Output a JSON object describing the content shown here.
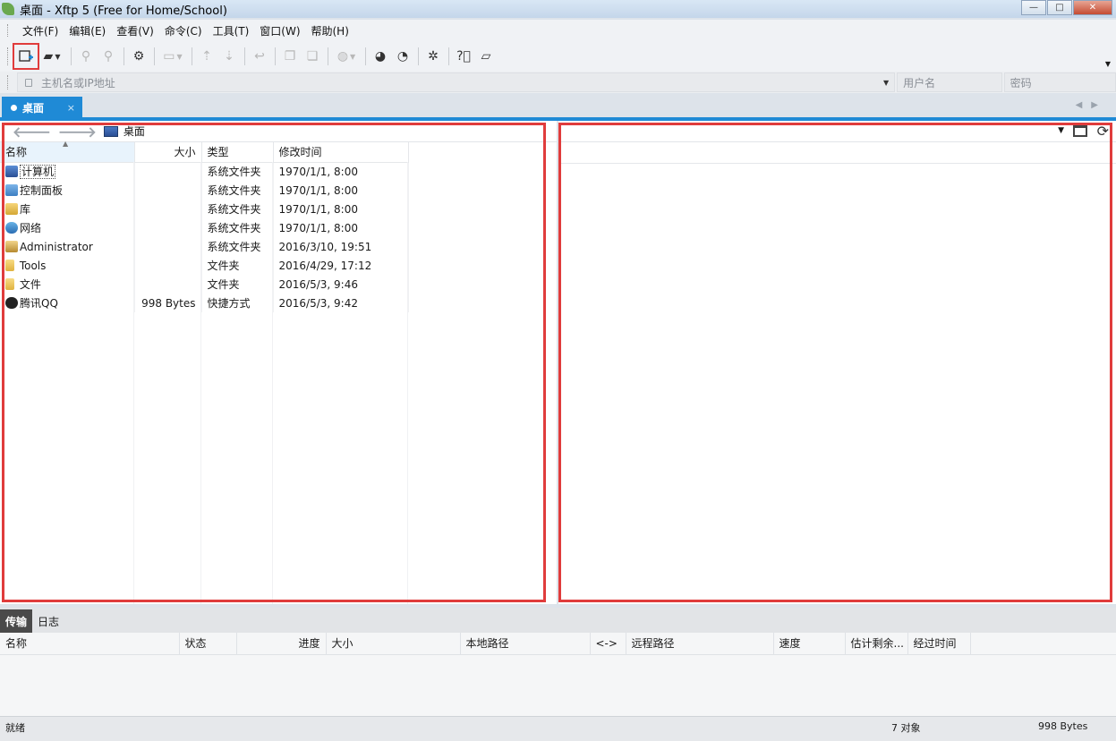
{
  "window": {
    "title": "桌面 - Xftp 5 (Free for Home/School)"
  },
  "menu": [
    "文件(F)",
    "编辑(E)",
    "查看(V)",
    "命令(C)",
    "工具(T)",
    "窗口(W)",
    "帮助(H)"
  ],
  "address": {
    "host_placeholder": "主机名或IP地址",
    "user_placeholder": "用户名",
    "password_placeholder": "密码"
  },
  "tab": {
    "label": "桌面",
    "close": "×"
  },
  "local": {
    "path": "桌面",
    "columns": [
      "名称",
      "大小",
      "类型",
      "修改时间"
    ],
    "rows": [
      {
        "name": "计算机",
        "size": "",
        "type": "系统文件夹",
        "modified": "1970/1/1, 8:00",
        "icon": "computer-icon"
      },
      {
        "name": "控制面板",
        "size": "",
        "type": "系统文件夹",
        "modified": "1970/1/1, 8:00",
        "icon": "control-panel-icon"
      },
      {
        "name": "库",
        "size": "",
        "type": "系统文件夹",
        "modified": "1970/1/1, 8:00",
        "icon": "library-icon"
      },
      {
        "name": "网络",
        "size": "",
        "type": "系统文件夹",
        "modified": "1970/1/1, 8:00",
        "icon": "network-icon"
      },
      {
        "name": "Administrator",
        "size": "",
        "type": "系统文件夹",
        "modified": "2016/3/10, 19:51",
        "icon": "user-folder-icon"
      },
      {
        "name": "Tools",
        "size": "",
        "type": "文件夹",
        "modified": "2016/4/29, 17:12",
        "icon": "folder-icon"
      },
      {
        "name": "文件",
        "size": "",
        "type": "文件夹",
        "modified": "2016/5/3, 9:46",
        "icon": "folder-icon"
      },
      {
        "name": "腾讯QQ",
        "size": "998 Bytes",
        "type": "快捷方式",
        "modified": "2016/5/3, 9:42",
        "icon": "qq-shortcut-icon"
      }
    ]
  },
  "bottom_tabs": [
    "传输",
    "日志"
  ],
  "transfer_columns": [
    "名称",
    "状态",
    "进度",
    "大小",
    "本地路径",
    "<->",
    "远程路径",
    "速度",
    "估计剩余...",
    "经过时间"
  ],
  "status": {
    "ready": "就绪",
    "objects": "7 对象",
    "size": "998 Bytes"
  },
  "colors": {
    "accent": "#1f8ad6",
    "highlight": "#e03c3c"
  }
}
